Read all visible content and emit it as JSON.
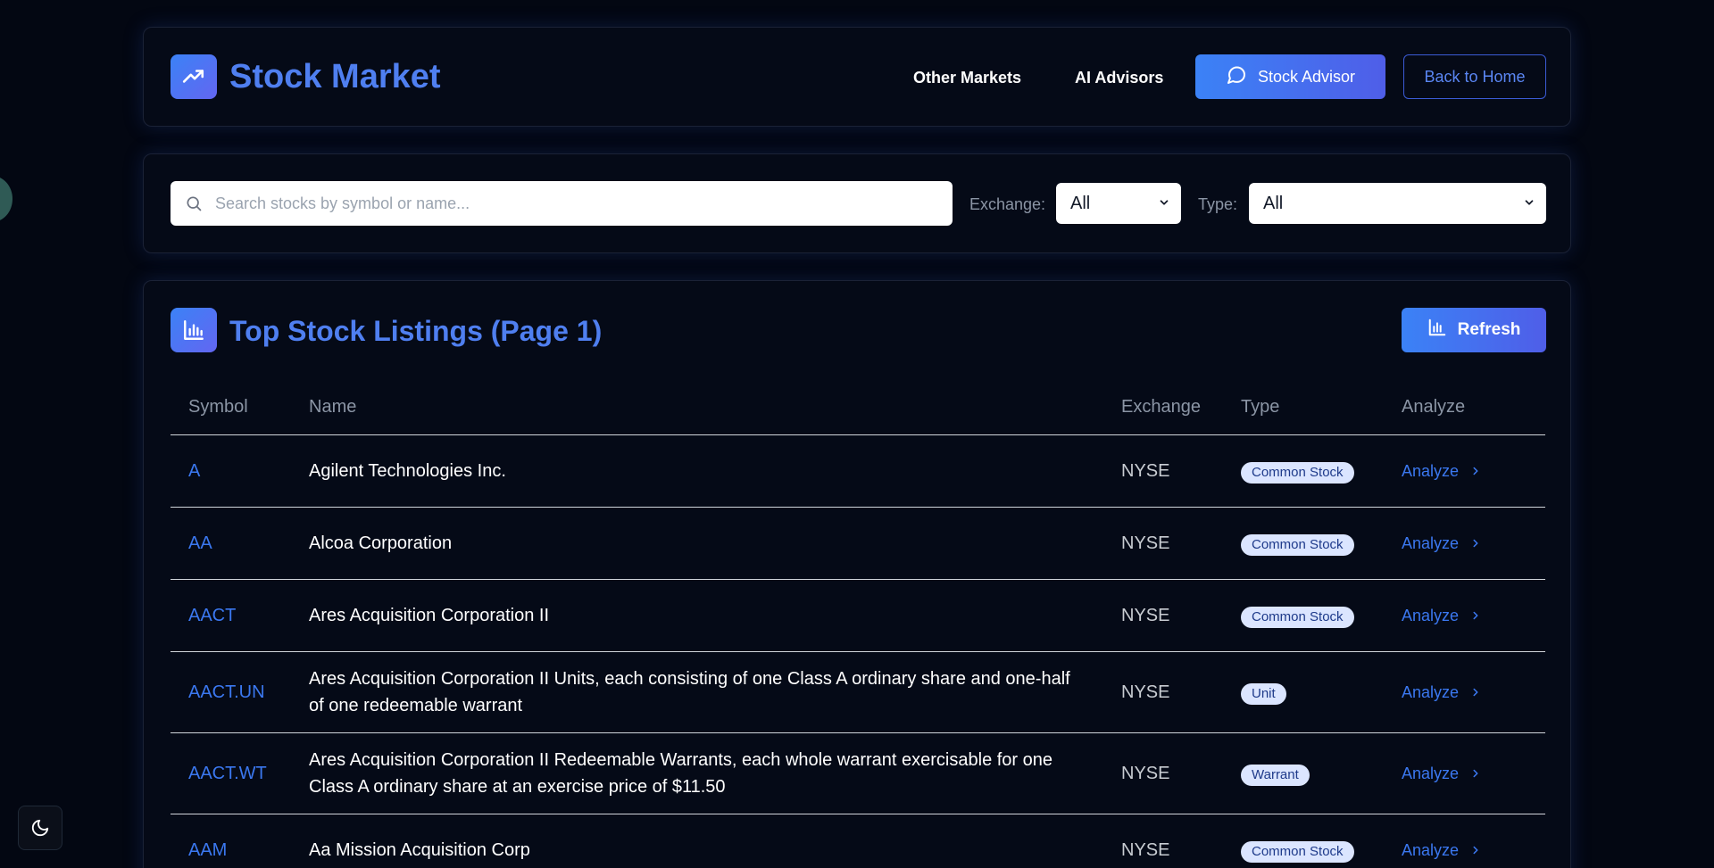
{
  "header": {
    "title": "Stock Market",
    "nav": {
      "other_markets": "Other Markets",
      "ai_advisors": "AI Advisors"
    },
    "stock_advisor_label": "Stock Advisor",
    "back_home_label": "Back to Home"
  },
  "search": {
    "placeholder": "Search stocks by symbol or name...",
    "value": "",
    "exchange_label": "Exchange:",
    "exchange_value": "All",
    "type_label": "Type:",
    "type_value": "All"
  },
  "listings": {
    "title": "Top Stock Listings (Page 1)",
    "refresh_label": "Refresh",
    "columns": [
      "Symbol",
      "Name",
      "Exchange",
      "Type",
      "Analyze"
    ],
    "rows": [
      {
        "symbol": "A",
        "name": "Agilent Technologies Inc.",
        "exchange": "NYSE",
        "type": "Common Stock",
        "analyze": "Analyze"
      },
      {
        "symbol": "AA",
        "name": "Alcoa Corporation",
        "exchange": "NYSE",
        "type": "Common Stock",
        "analyze": "Analyze"
      },
      {
        "symbol": "AACT",
        "name": "Ares Acquisition Corporation II",
        "exchange": "NYSE",
        "type": "Common Stock",
        "analyze": "Analyze"
      },
      {
        "symbol": "AACT.UN",
        "name": "Ares Acquisition Corporation II Units, each consisting of one Class A ordinary share and one-half of one redeemable warrant",
        "exchange": "NYSE",
        "type": "Unit",
        "analyze": "Analyze"
      },
      {
        "symbol": "AACT.WT",
        "name": "Ares Acquisition Corporation II Redeemable Warrants, each whole warrant exercisable for one Class A ordinary share at an exercise price of $11.50",
        "exchange": "NYSE",
        "type": "Warrant",
        "analyze": "Analyze"
      },
      {
        "symbol": "AAM",
        "name": "Aa Mission Acquisition Corp",
        "exchange": "NYSE",
        "type": "Common Stock",
        "analyze": "Analyze"
      }
    ]
  },
  "icons": {
    "brand": "trending-up-icon",
    "advisor": "message-circle-icon",
    "search": "search-icon",
    "select": "chevron-down-icon",
    "listings": "bar-chart-icon",
    "analyze": "chevron-right-icon",
    "theme": "moon-icon"
  },
  "colors": {
    "background": "#030712",
    "accent": "#3b82f6",
    "title": "#4f7ff0",
    "badge_bg": "#dbe5ff",
    "badge_text": "#1e3a8a"
  }
}
